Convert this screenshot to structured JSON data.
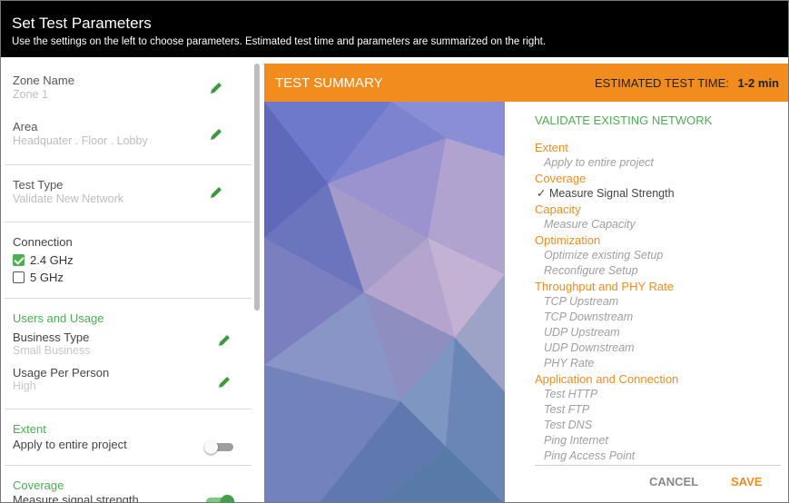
{
  "header": {
    "title": "Set Test Parameters",
    "subtitle": "Use the settings on the left to choose parameters. Estimated test time and parameters are summarized on the right."
  },
  "left": {
    "zone": {
      "label": "Zone Name",
      "value": "Zone 1"
    },
    "area": {
      "label": "Area",
      "value": "Headquater . Floor . Lobby"
    },
    "test_type": {
      "label": "Test Type",
      "value": "Validate New Network"
    },
    "connection": {
      "label": "Connection",
      "options": [
        {
          "label": "2.4 GHz",
          "checked": true
        },
        {
          "label": "5 GHz",
          "checked": false
        }
      ]
    },
    "users": {
      "title": "Users and Usage",
      "business_type": {
        "label": "Business Type",
        "value": "Small Business"
      },
      "usage": {
        "label": "Usage Per Person",
        "value": "High"
      }
    },
    "extent": {
      "title": "Extent",
      "label": "Apply to entire project",
      "on": false
    },
    "coverage": {
      "title": "Coverage",
      "label": "Measure signal strength",
      "on": true
    }
  },
  "summary": {
    "bar_title": "TEST SUMMARY",
    "est_label": "ESTIMATED TEST TIME:",
    "est_value": "1-2 min",
    "headline": "VALIDATE EXISTING NETWORK",
    "sections": [
      {
        "title": "Extent",
        "items": [
          {
            "text": "Apply to entire project",
            "selected": false
          }
        ]
      },
      {
        "title": "Coverage",
        "items": [
          {
            "text": "✓ Measure Signal Strength",
            "selected": true
          }
        ]
      },
      {
        "title": "Capacity",
        "items": [
          {
            "text": "Measure Capacity",
            "selected": false
          }
        ]
      },
      {
        "title": "Optimization",
        "items": [
          {
            "text": "Optimize existing Setup",
            "selected": false
          },
          {
            "text": "Reconfigure Setup",
            "selected": false
          }
        ]
      },
      {
        "title": "Throughput and PHY Rate",
        "items": [
          {
            "text": "TCP Upstream",
            "selected": false
          },
          {
            "text": "TCP Downstream",
            "selected": false
          },
          {
            "text": "UDP Upstream",
            "selected": false
          },
          {
            "text": "UDP Downstream",
            "selected": false
          },
          {
            "text": "PHY Rate",
            "selected": false
          }
        ]
      },
      {
        "title": "Application and Connection",
        "items": [
          {
            "text": "Test HTTP",
            "selected": false
          },
          {
            "text": "Test FTP",
            "selected": false
          },
          {
            "text": "Test DNS",
            "selected": false
          },
          {
            "text": "Ping Internet",
            "selected": false
          },
          {
            "text": "Ping Access Point",
            "selected": false
          }
        ]
      }
    ],
    "cancel_label": "CANCEL",
    "save_label": "SAVE"
  },
  "colors": {
    "accent": "#f28c1e",
    "success": "#4caf50",
    "header_bg": "#000000"
  },
  "icons": {
    "edit": "pencil-icon",
    "check": "checkbox-icon",
    "toggle": "toggle-switch"
  }
}
